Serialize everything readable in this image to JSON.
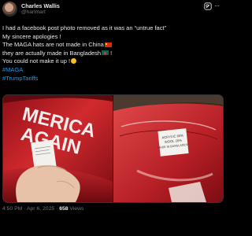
{
  "author": {
    "name": "Charles Wallis",
    "handle": "@harlmart"
  },
  "post": {
    "lines": [
      "I had a facebook post photo removed as it was an “untrue fact”",
      "My sincere apologies !",
      "The MAGA hats are not made in China",
      "they are actually made in  Bangladesh",
      "You could not make it up !"
    ],
    "line3_suffix": "",
    "line4_suffix": " !",
    "hashtags": [
      "#MAGA",
      "#TrumpTariffs"
    ]
  },
  "media": {
    "left_photo_text": [
      "MERICA",
      "AGAIN"
    ],
    "right_label_lines": [
      "ACRYLIC 80%",
      "WOOL 20%",
      "MADE IN BANGLADESH"
    ]
  },
  "meta": {
    "time": "4:50 PM",
    "date": "Apr 6, 2025",
    "views": "658",
    "views_label": "Views",
    "separator": "·"
  },
  "icons": {
    "grok": "grok-icon",
    "more": "more-icon",
    "china_flag": "china-flag-icon",
    "bangladesh_flag": "bangladesh-flag-icon",
    "laugh": "laughing-emoji-icon"
  }
}
